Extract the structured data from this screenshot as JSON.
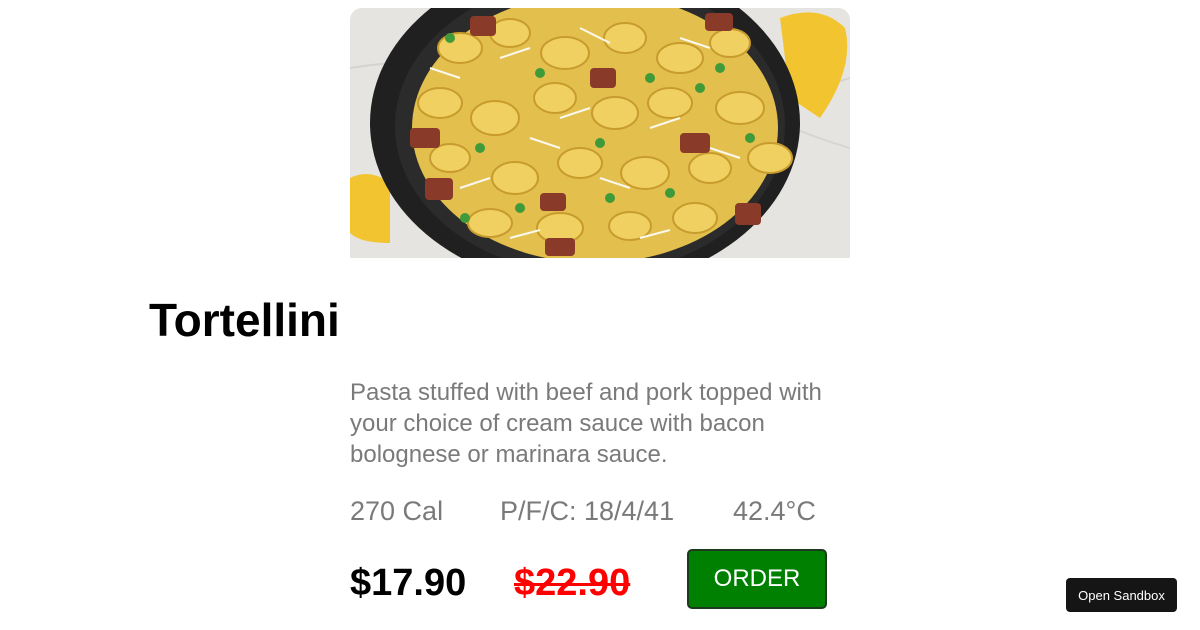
{
  "dish": {
    "image_alt": "Tortellini",
    "title": "Tortellini",
    "description": "Pasta stuffed with beef and pork topped with your choice of cream sauce with bacon bolognese or marinara sauce.",
    "calories": "270 Cal",
    "macros": "P/F/C: 18/4/41",
    "temperature": "42.4°C",
    "price": "$17.90",
    "old_price": "$22.90",
    "order_label": "ORDER"
  },
  "sandbox": {
    "label": "Open Sandbox"
  },
  "colors": {
    "order_button": "#008000",
    "old_price": "#ff0000",
    "muted_text": "#7a7a7a",
    "sandbox_bg": "#151515"
  }
}
